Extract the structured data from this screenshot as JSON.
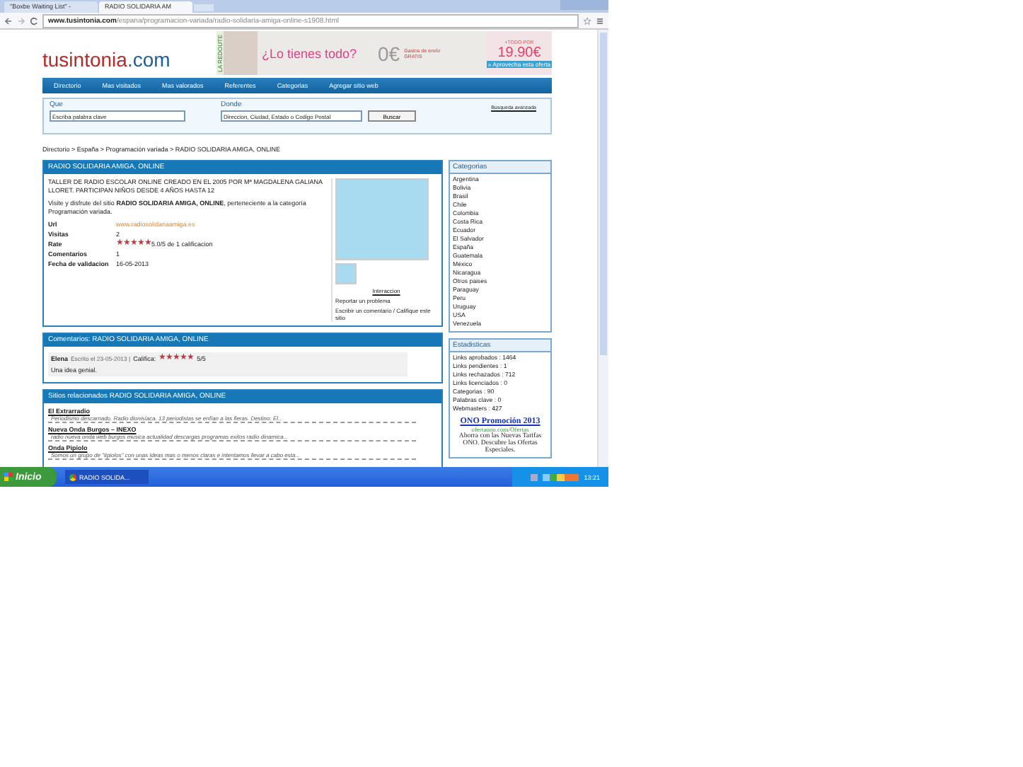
{
  "browser": {
    "tabs": [
      {
        "label": "\"Boxbe Waiting List\" -",
        "selected": false
      },
      {
        "label": "RADIO SOLIDARIA AM",
        "selected": true
      }
    ],
    "url_domain": "www.tusintonia.com",
    "url_path": "/espana/programacion-variada/radio-solidaria-amiga-online-s1908.html"
  },
  "site": {
    "logo_name": "tusintonia",
    "logo_tld": ".com"
  },
  "ad": {
    "brand": "LA REDOUTE",
    "headline": "¿Lo tienes todo?",
    "price_zero": "0€",
    "shipping": "Gastos de envío GRATIS",
    "todo_por": "+TODO POR",
    "price": "19.90€",
    "cta": "» Aprovecha esta oferta"
  },
  "nav": [
    "Directorio",
    "Mas visitados",
    "Mas valorados",
    "Referentes",
    "Categorias",
    "Agregar sitio web"
  ],
  "search": {
    "que_label": "Que",
    "que_placeholder": "Escriba palabra clave",
    "donde_label": "Donde",
    "donde_placeholder": "Direccion, Ciudad, Estado o Codigo Postal",
    "button": "Buscar",
    "advanced": "Busqueda avanzada"
  },
  "breadcrumb": "Directorio > España > Programación variada > RADIO SOLIDARIA AMIGA, ONLINE",
  "listing": {
    "title": "RADIO SOLIDARIA AMIGA, ONLINE",
    "description": "TALLER DE RADIO ESCOLAR ONLINE CREADO EN EL 2005 POR Mª MAGDALENA GALIANA LLORET. PARTICIPAN NIÑOS DESDE 4 AÑOS HASTA 12",
    "visit": "Visite y disfrute del sitio **RADIO SOLIDARIA AMIGA, ONLINE**, perteneciente a la categoría Programación variada.",
    "fields": [
      {
        "label": "Url",
        "kind": "link",
        "value": "www.radiosolidariaamiga.es"
      },
      {
        "label": "Visitas",
        "kind": "text",
        "value": "2"
      },
      {
        "label": "Rate",
        "kind": "stars",
        "stars": 5,
        "value": "5.0/5 de 1 calificacion"
      },
      {
        "label": "Comentarios",
        "kind": "text",
        "value": "1"
      },
      {
        "label": "Fecha de validacion",
        "kind": "text",
        "value": "16-05-2013"
      }
    ],
    "interaction_title": "Interaccion",
    "interaction_links": [
      "Reportar un problema",
      "Escribir un comentario / Califique este sitio"
    ]
  },
  "comments": {
    "title": "Comentarios: RADIO SOLIDARIA AMIGA, ONLINE",
    "items": [
      {
        "author": "Elena",
        "meta": "Escrito el 23-05-2013 |",
        "rate_label": "Califica:",
        "stars": 5,
        "score": "5/5",
        "text": "Una idea genial."
      }
    ]
  },
  "related": {
    "title": "Sitios relacionados RADIO SOLIDARIA AMIGA, ONLINE",
    "items": [
      {
        "name": "El Extrarradio",
        "text": "Periodismo descarnado. Radio dionisíaca. 13 periodistas se enfían a las fieras. Destino: El..."
      },
      {
        "name": "Nueva Onda Burgos – INEXO",
        "text": "radio nueva onda web burgos musica actualidad descargas programas exitos radio dinamica..."
      },
      {
        "name": "Onda Pipiolo",
        "text": "Somos un grupo de \"tipiolos\" con unas ideas mas o menos claras e intentamos llevar a cabo esta..."
      }
    ]
  },
  "categories": {
    "title": "Categorias",
    "items": [
      "Argentina",
      "Bolivia",
      "Brasil",
      "Chile",
      "Colombia",
      "Costa Rica",
      "Ecuador",
      "El Salvador",
      "España",
      "Guatemala",
      "México",
      "Nicaragua",
      "Otros paises",
      "Paraguay",
      "Peru",
      "Uruguay",
      "USA",
      "Venezuela"
    ]
  },
  "stats": {
    "title": "Estadisticas",
    "items": [
      "Links aprobados : 1464",
      "Links pendientes : 1",
      "Links rechazados : 712",
      "Links licenciados : 0",
      "Categorias : 90",
      "Palabras clave : 0",
      "Webmasters : 427"
    ]
  },
  "ono_ad": {
    "title": "ONO Promoción 2013",
    "url": "ofertaono.com/Ofertas",
    "text": "Ahorra con las Nuevas Tarifas ONO. Descubre las Ofertas Especiales."
  },
  "taskbar": {
    "start": "Inicio",
    "window": "RADIO SOLIDA...",
    "clock": "13:21"
  }
}
